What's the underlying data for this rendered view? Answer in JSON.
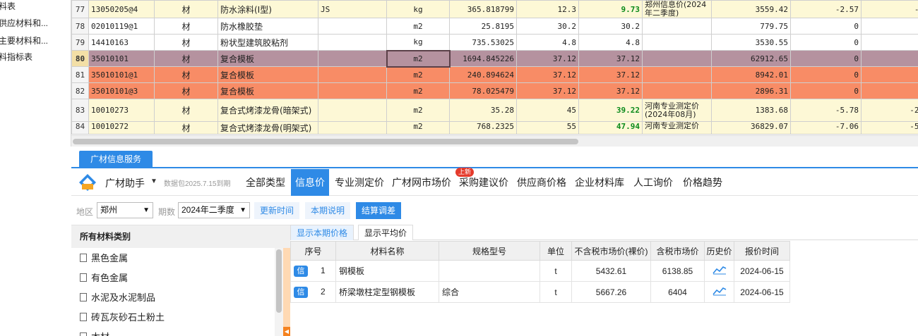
{
  "sidebar": {
    "items": [
      "料表",
      "供应材料和...",
      "主要材料和...",
      "料指标表"
    ]
  },
  "grid": {
    "rows": [
      {
        "rn": "77",
        "code": "13050205@4",
        "type": "材",
        "name": "防水涂料(I型)",
        "spec": "JS",
        "unit": "kg",
        "qty": "365.818799",
        "price1": "12.3",
        "price2": "9.73",
        "source": "郑州信息价(2024年二季度)",
        "amount": "3559.42",
        "diff": "-2.57",
        "total": "-940.",
        "price2_green": true,
        "style": "yellow"
      },
      {
        "rn": "78",
        "code": "02010119@1",
        "type": "材",
        "name": "防水橡胶垫",
        "spec": "",
        "unit": "m2",
        "qty": "25.8195",
        "price1": "30.2",
        "price2": "30.2",
        "source": "",
        "amount": "779.75",
        "diff": "0",
        "total": "",
        "price2_green": false,
        "style": "plain"
      },
      {
        "rn": "79",
        "code": "14410163",
        "type": "材",
        "name": "粉状型建筑胶粘剂",
        "spec": "",
        "unit": "kg",
        "qty": "735.53025",
        "price1": "4.8",
        "price2": "4.8",
        "source": "",
        "amount": "3530.55",
        "diff": "0",
        "total": "",
        "price2_green": false,
        "style": "plain"
      },
      {
        "rn": "80",
        "code": "35010101",
        "type": "材",
        "name": "复合模板",
        "spec": "",
        "unit": "m2",
        "qty": "1694.845226",
        "price1": "37.12",
        "price2": "37.12",
        "source": "",
        "amount": "62912.65",
        "diff": "0",
        "total": "",
        "price2_green": false,
        "style": "sel"
      },
      {
        "rn": "81",
        "code": "35010101@1",
        "type": "材",
        "name": "复合模板",
        "spec": "",
        "unit": "m2",
        "qty": "240.894624",
        "price1": "37.12",
        "price2": "37.12",
        "source": "",
        "amount": "8942.01",
        "diff": "0",
        "total": "",
        "price2_green": false,
        "style": "orange"
      },
      {
        "rn": "82",
        "code": "35010101@3",
        "type": "材",
        "name": "复合模板",
        "spec": "",
        "unit": "m2",
        "qty": "78.025479",
        "price1": "37.12",
        "price2": "37.12",
        "source": "",
        "amount": "2896.31",
        "diff": "0",
        "total": "",
        "price2_green": false,
        "style": "orange"
      },
      {
        "rn": "83",
        "code": "10010273",
        "type": "材",
        "name": "复合式烤漆龙骨(暗架式)",
        "spec": "",
        "unit": "m2",
        "qty": "35.28",
        "price1": "45",
        "price2": "39.22",
        "source": "河南专业测定价(2024年08月)",
        "amount": "1383.68",
        "diff": "-5.78",
        "total": "-203.9",
        "price2_green": true,
        "style": "yellow tall"
      },
      {
        "rn": "84",
        "code": "10010272",
        "type": "材",
        "name": "复合式烤漆龙骨(明架式)",
        "spec": "",
        "unit": "m2",
        "qty": "768.2325",
        "price1": "55",
        "price2": "47.94",
        "source": "河南专业测定价",
        "amount": "36829.07",
        "diff": "-7.06",
        "total": "-5423.",
        "price2_green": true,
        "style": "yellow cut"
      }
    ]
  },
  "service_tab": "广材信息服务",
  "toolbar": {
    "assistant": "广材助手",
    "caret": "▼",
    "package": "数据包2025.7.15到期",
    "tabs": [
      "全部类型",
      "信息价",
      "专业测定价",
      "广材网市场价",
      "采购建议价",
      "供应商价格",
      "企业材料库",
      "人工询价",
      "价格趋势"
    ],
    "active_tab": "信息价",
    "new_badge": "上新"
  },
  "filters": {
    "region_label": "地区",
    "region_value": "郑州",
    "period_label": "期数",
    "period_value": "2024年二季度",
    "buttons": [
      "更新时间",
      "本期说明",
      "结算调差"
    ]
  },
  "categories": {
    "header": "所有材料类别",
    "items": [
      "黑色金属",
      "有色金属",
      "水泥及水泥制品",
      "砖瓦灰砂石土粉土",
      "木材"
    ]
  },
  "price_tabs": [
    "显示本期价格",
    "显示平均价"
  ],
  "price_table": {
    "headers": [
      "序号",
      "材料名称",
      "规格型号",
      "单位",
      "不含税市场价(裸价)",
      "含税市场价",
      "历史价",
      "报价时间"
    ],
    "rows": [
      {
        "badge": "信",
        "no": "1",
        "name": "钢模板",
        "spec": "",
        "unit": "t",
        "price_ex": "5432.61",
        "price_in": "6138.85",
        "date": "2024-06-15"
      },
      {
        "badge": "信",
        "no": "2",
        "name": "桥梁墩柱定型钢模板",
        "spec": "综合",
        "unit": "t",
        "price_ex": "5667.26",
        "price_in": "6404",
        "date": "2024-06-15"
      }
    ]
  },
  "colors": {
    "accent": "#2e8ae6",
    "selected_row": "#b5929f",
    "orange_row": "#f88c66",
    "yellow_row": "#fdf8d6",
    "green_value": "#0a8a1a"
  }
}
